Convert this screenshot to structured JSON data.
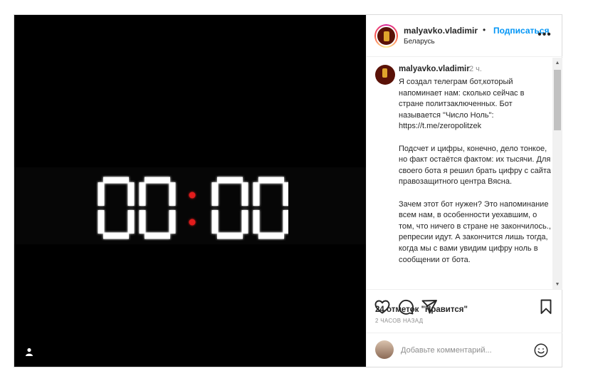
{
  "post": {
    "username": "malyavko.vladimir",
    "separator": "•",
    "follow_label": "Подписаться",
    "location": "Беларусь",
    "more_label": "•••",
    "media": {
      "clock_text": "00:00",
      "digit_color": "#ffffff",
      "colon_color": "#e21b1b"
    }
  },
  "comment": {
    "username": "malyavko.vladimir",
    "time": "2 ч.",
    "text": "Я создал телеграм бот,который напоминает нам: сколько сейчас в стране политзаключенных. Бот называется \"Число Ноль\": https://t.me/zeropolitzek\n\nПодсчет и цифры, конечно, дело тонкое, но факт остаётся фактом: их тысячи. Для своего бота я решил брать цифру с сайта правозащитного центра Вясна.\n\nЗачем этот бот нужен? Это напоминание всем нам, в особенности уехавшим, о том, что ничего в стране не закончилось., репресии идут. А закончится лишь тогда, когда мы с вами увидим цифру ноль в сообщении от бота."
  },
  "scrollbar": {
    "up": "▲",
    "down": "▼"
  },
  "actions": {
    "icons": [
      "heart-icon",
      "comment-icon",
      "share-icon",
      "bookmark-icon"
    ]
  },
  "likes_text": "24 отметок \"Нравится\"",
  "posted_ago": "2 часов назад",
  "add_comment": {
    "placeholder": "Добавьте комментарий..."
  },
  "colors": {
    "accent": "#0095f6",
    "text": "#262626",
    "muted": "#8e8e8e",
    "border": "#dbdbdb"
  }
}
